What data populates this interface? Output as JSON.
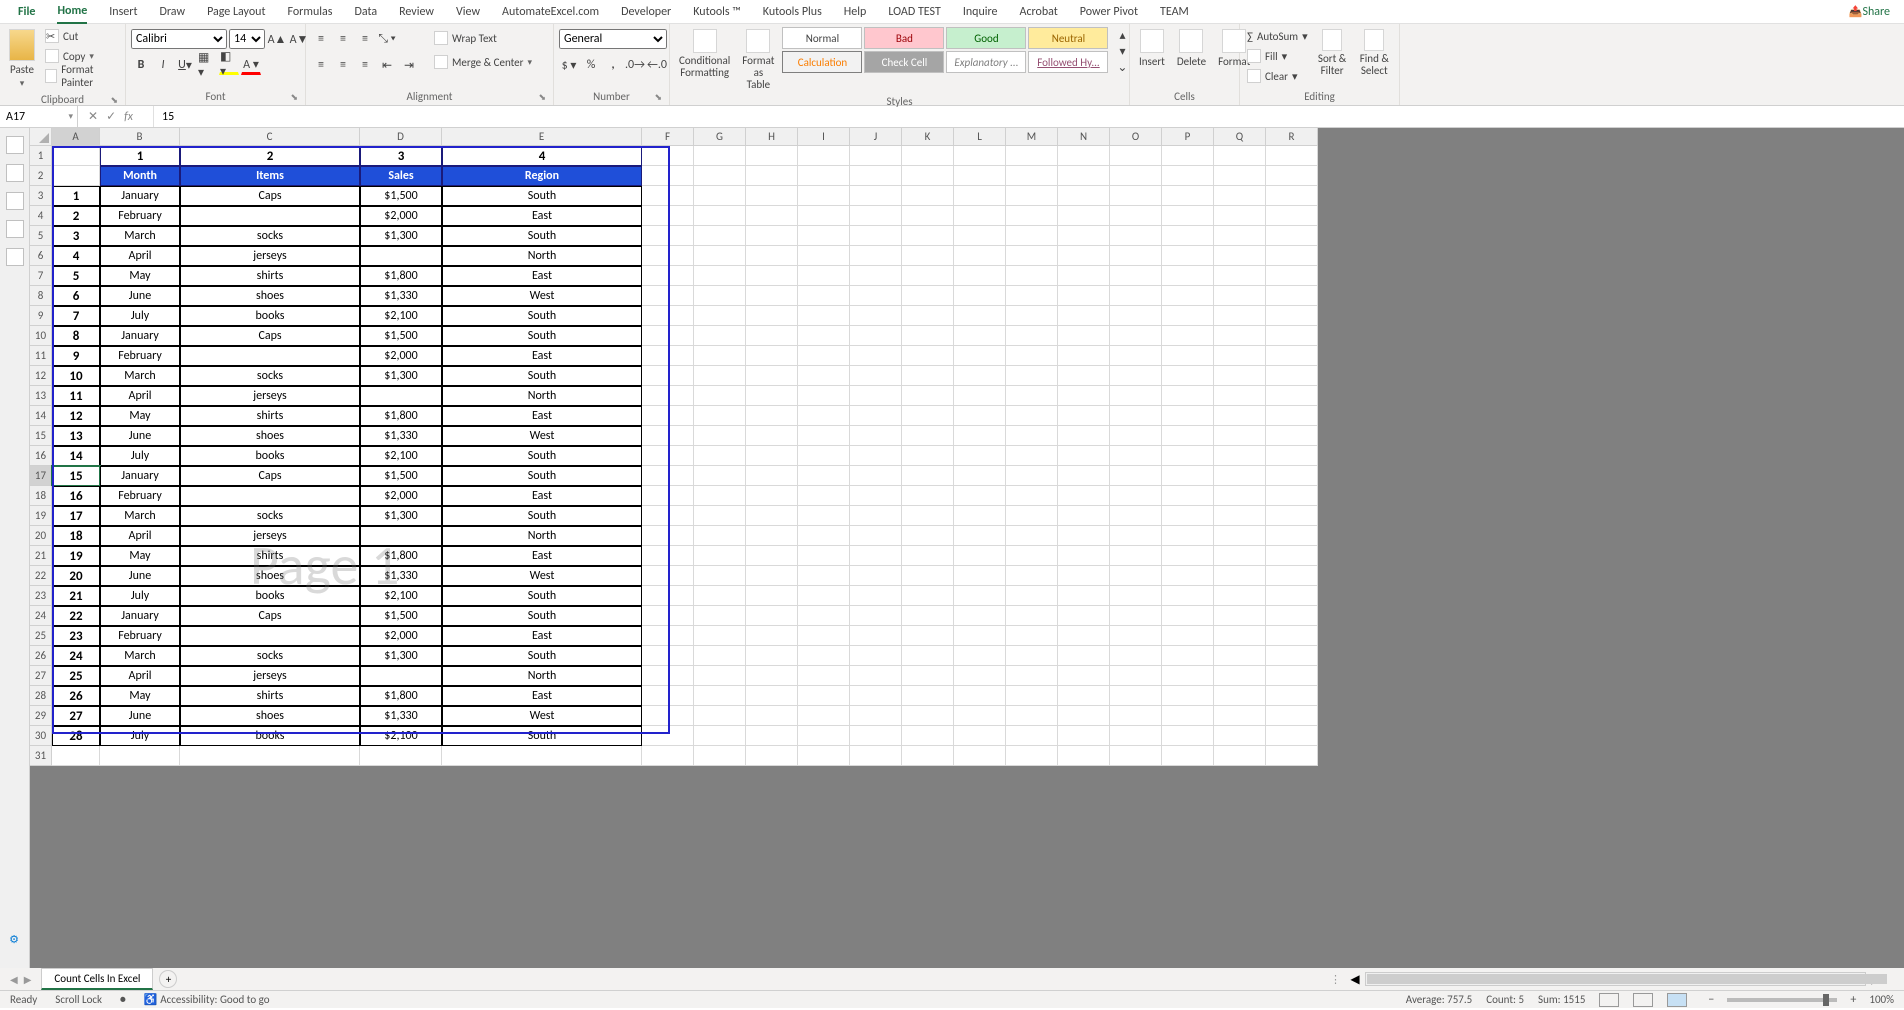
{
  "tabs": [
    "File",
    "Home",
    "Insert",
    "Draw",
    "Page Layout",
    "Formulas",
    "Data",
    "Review",
    "View",
    "AutomateExcel.com",
    "Developer",
    "Kutools ™",
    "Kutools Plus",
    "Help",
    "LOAD TEST",
    "Inquire",
    "Acrobat",
    "Power Pivot",
    "TEAM"
  ],
  "active_tab": "Home",
  "share": "Share",
  "clipboard": {
    "paste": "Paste",
    "cut": "Cut",
    "copy": "Copy",
    "fmt": "Format Painter",
    "label": "Clipboard"
  },
  "font": {
    "name": "Calibri",
    "size": "14",
    "label": "Font"
  },
  "alignment": {
    "wrap": "Wrap Text",
    "merge": "Merge & Center",
    "label": "Alignment"
  },
  "number": {
    "fmt": "General",
    "label": "Number"
  },
  "styles": {
    "cond": "Conditional Formatting",
    "fat": "Format as Table",
    "items": [
      "Normal",
      "Bad",
      "Good",
      "Neutral",
      "Calculation",
      "Check Cell",
      "Explanatory ...",
      "Followed Hy..."
    ],
    "label": "Styles"
  },
  "cells": {
    "insert": "Insert",
    "delete": "Delete",
    "format": "Format",
    "label": "Cells"
  },
  "editing": {
    "autosum": "AutoSum",
    "fill": "Fill",
    "clear": "Clear",
    "sort": "Sort & Filter",
    "find": "Find & Select",
    "label": "Editing"
  },
  "name_box": "A17",
  "formula": "15",
  "col_widths": {
    "A": 48,
    "B": 80,
    "C": 180,
    "D": 82,
    "E": 200,
    "F": 52,
    "G": 52,
    "H": 52,
    "I": 52,
    "J": 52,
    "K": 52,
    "L": 52,
    "M": 52,
    "N": 52,
    "O": 52,
    "P": 52,
    "Q": 52,
    "R": 52
  },
  "cols": [
    "A",
    "B",
    "C",
    "D",
    "E",
    "F",
    "G",
    "H",
    "I",
    "J",
    "K",
    "L",
    "M",
    "N",
    "O",
    "P",
    "Q",
    "R"
  ],
  "top_numbers": [
    "1",
    "2",
    "3",
    "4"
  ],
  "headers": [
    "Month",
    "Items",
    "Sales",
    "Region"
  ],
  "rows": [
    {
      "n": "1",
      "m": "January",
      "i": "Caps",
      "s": "$1,500",
      "r": "South"
    },
    {
      "n": "2",
      "m": "February",
      "i": "",
      "s": "$2,000",
      "r": "East"
    },
    {
      "n": "3",
      "m": "March",
      "i": "socks",
      "s": "$1,300",
      "r": "South"
    },
    {
      "n": "4",
      "m": "April",
      "i": "jerseys",
      "s": "",
      "r": "North"
    },
    {
      "n": "5",
      "m": "May",
      "i": "shirts",
      "s": "$1,800",
      "r": "East"
    },
    {
      "n": "6",
      "m": "June",
      "i": "shoes",
      "s": "$1,330",
      "r": "West"
    },
    {
      "n": "7",
      "m": "July",
      "i": "books",
      "s": "$2,100",
      "r": "South"
    },
    {
      "n": "8",
      "m": "January",
      "i": "Caps",
      "s": "$1,500",
      "r": "South"
    },
    {
      "n": "9",
      "m": "February",
      "i": "",
      "s": "$2,000",
      "r": "East"
    },
    {
      "n": "10",
      "m": "March",
      "i": "socks",
      "s": "$1,300",
      "r": "South"
    },
    {
      "n": "11",
      "m": "April",
      "i": "jerseys",
      "s": "",
      "r": "North"
    },
    {
      "n": "12",
      "m": "May",
      "i": "shirts",
      "s": "$1,800",
      "r": "East"
    },
    {
      "n": "13",
      "m": "June",
      "i": "shoes",
      "s": "$1,330",
      "r": "West"
    },
    {
      "n": "14",
      "m": "July",
      "i": "books",
      "s": "$2,100",
      "r": "South"
    },
    {
      "n": "15",
      "m": "January",
      "i": "Caps",
      "s": "$1,500",
      "r": "South"
    },
    {
      "n": "16",
      "m": "February",
      "i": "",
      "s": "$2,000",
      "r": "East"
    },
    {
      "n": "17",
      "m": "March",
      "i": "socks",
      "s": "$1,300",
      "r": "South"
    },
    {
      "n": "18",
      "m": "April",
      "i": "jerseys",
      "s": "",
      "r": "North"
    },
    {
      "n": "19",
      "m": "May",
      "i": "shirts",
      "s": "$1,800",
      "r": "East"
    },
    {
      "n": "20",
      "m": "June",
      "i": "shoes",
      "s": "$1,330",
      "r": "West"
    },
    {
      "n": "21",
      "m": "July",
      "i": "books",
      "s": "$2,100",
      "r": "South"
    },
    {
      "n": "22",
      "m": "January",
      "i": "Caps",
      "s": "$1,500",
      "r": "South"
    },
    {
      "n": "23",
      "m": "February",
      "i": "",
      "s": "$2,000",
      "r": "East"
    },
    {
      "n": "24",
      "m": "March",
      "i": "socks",
      "s": "$1,300",
      "r": "South"
    },
    {
      "n": "25",
      "m": "April",
      "i": "jerseys",
      "s": "",
      "r": "North"
    },
    {
      "n": "26",
      "m": "May",
      "i": "shirts",
      "s": "$1,800",
      "r": "East"
    },
    {
      "n": "27",
      "m": "June",
      "i": "shoes",
      "s": "$1,330",
      "r": "West"
    },
    {
      "n": "28",
      "m": "July",
      "i": "books",
      "s": "$2,100",
      "r": "South"
    }
  ],
  "watermark": "Page 1",
  "sheet_tab": "Count Cells In Excel",
  "status": {
    "ready": "Ready",
    "scroll": "Scroll Lock",
    "acc": "Accessibility: Good to go",
    "avg": "Average: 757.5",
    "count": "Count: 5",
    "sum": "Sum: 1515",
    "zoom": "100%"
  }
}
